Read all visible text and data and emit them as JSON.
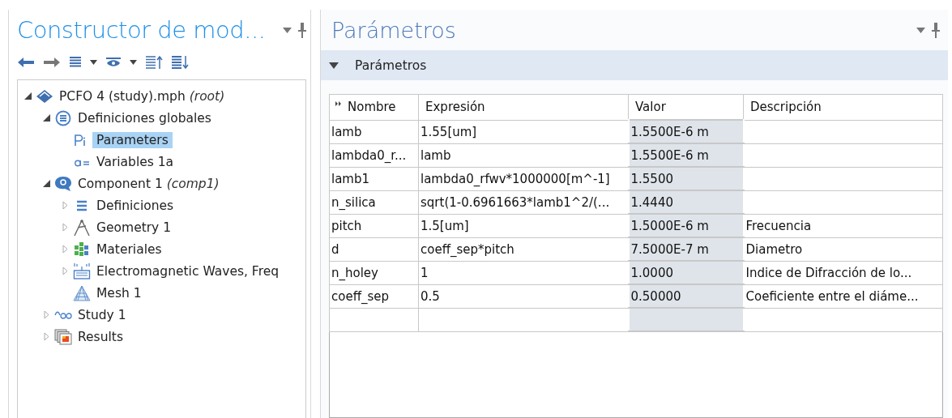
{
  "model_builder": {
    "title": "Constructor de mod...",
    "tree": [
      {
        "label": "PCFO 4 (study).mph",
        "note": "(root)",
        "kind": "file",
        "expanded": true,
        "selected": false,
        "children": [
          {
            "label": "Definiciones globales",
            "kind": "globaldefs",
            "expanded": true,
            "selected": false,
            "children": [
              {
                "label": "Parameters",
                "kind": "params",
                "selected": true
              },
              {
                "label": "Variables 1a",
                "kind": "vars",
                "selected": false
              }
            ]
          },
          {
            "label": "Component 1",
            "note": "(comp1)",
            "kind": "component",
            "expanded": true,
            "selected": false,
            "children": [
              {
                "label": "Definiciones",
                "kind": "defs",
                "expanded": false,
                "selected": false
              },
              {
                "label": "Geometry 1",
                "kind": "geometry",
                "expanded": false,
                "selected": false
              },
              {
                "label": "Materiales",
                "kind": "materials",
                "expanded": false,
                "selected": false
              },
              {
                "label": "Electromagnetic Waves, Freq",
                "kind": "emw",
                "expanded": false,
                "selected": false
              },
              {
                "label": "Mesh 1",
                "kind": "mesh",
                "selected": false
              }
            ]
          },
          {
            "label": "Study 1",
            "kind": "study",
            "expanded": false,
            "selected": false
          },
          {
            "label": "Results",
            "kind": "results",
            "expanded": false,
            "selected": false
          }
        ]
      }
    ]
  },
  "settings": {
    "title": "Parámetros",
    "section": {
      "label": "Parámetros",
      "expanded": true
    },
    "table": {
      "columns": [
        "Nombre",
        "Expresión",
        "Valor",
        "Descripción"
      ],
      "rows": [
        [
          "lamb",
          "1.55[um]",
          "1.5500E-6 m",
          ""
        ],
        [
          "lambda0_r...",
          "lamb",
          "1.5500E-6 m",
          ""
        ],
        [
          "lamb1",
          "lambda0_rfwv*1000000[m^-1]",
          "1.5500",
          ""
        ],
        [
          "n_silica",
          "sqrt(1-0.6961663*lamb1^2/(...",
          "1.4440",
          ""
        ],
        [
          "pitch",
          "1.5[um]",
          "1.5000E-6 m",
          "Frecuencia"
        ],
        [
          "d",
          "coeff_sep*pitch",
          "7.5000E-7 m",
          "Diametro"
        ],
        [
          "n_holey",
          "1",
          "1.0000",
          "Indice de Difracción de lo..."
        ],
        [
          "coeff_sep",
          "0.5",
          "0.50000",
          "Coeficiente entre el diáme..."
        ]
      ]
    }
  }
}
